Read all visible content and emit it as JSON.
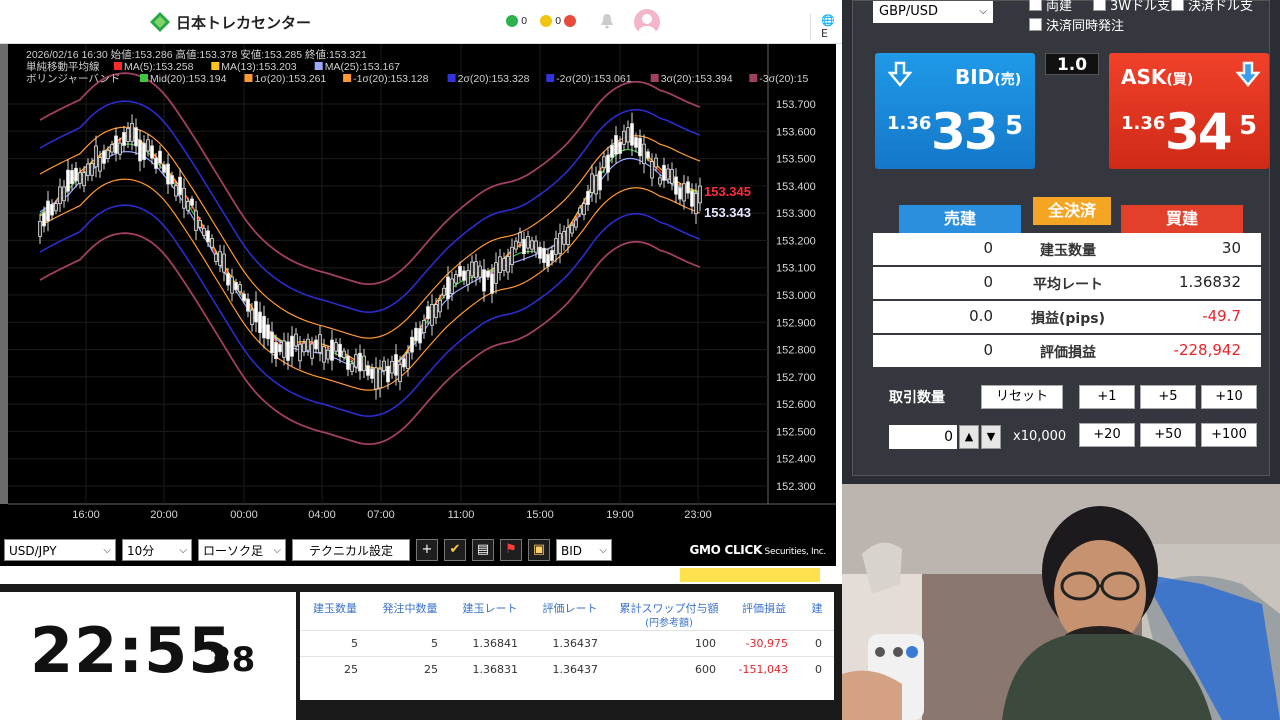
{
  "header": {
    "brand": "日本トレカセンター",
    "ind1": "0",
    "ind2": "0",
    "lang": "E"
  },
  "chart": {
    "info_line1": "2026/02/16 16:30 始値:153.286 高値:153.378 安値:153.285 終値:153.321",
    "info_line2_label": "単純移動平均線",
    "ma": [
      {
        "text": "MA(5):153.258",
        "color": "#ff2b2b"
      },
      {
        "text": "MA(13):153.203",
        "color": "#ffc21c"
      },
      {
        "text": "MA(25):153.167",
        "color": "#9aa8ff"
      }
    ],
    "info_line3_label": "ボリンジャーバンド",
    "bb": [
      {
        "text": "Mid(20):153.194",
        "color": "#3ec63e"
      },
      {
        "text": "1σ(20):153.261",
        "color": "#ff9933"
      },
      {
        "text": "-1σ(20):153.128",
        "color": "#ff9933"
      },
      {
        "text": "2σ(20):153.328",
        "color": "#3333dd"
      },
      {
        "text": "-2σ(20):153.061",
        "color": "#3333dd"
      },
      {
        "text": "3σ(20):153.394",
        "color": "#a04060"
      },
      {
        "text": "-3σ(20):15",
        "color": "#a04060"
      }
    ],
    "price_ask": "153.345",
    "price_bid": "153.343",
    "yticks": [
      "153.700",
      "153.600",
      "153.500",
      "153.400",
      "153.300",
      "153.200",
      "153.100",
      "153.000",
      "152.900",
      "152.800",
      "152.700",
      "152.600",
      "152.500",
      "152.400",
      "152.300"
    ],
    "xticks": [
      "16:00",
      "20:00",
      "00:00",
      "04:00",
      "07:00",
      "11:00",
      "15:00",
      "19:00",
      "23:00"
    ],
    "ylim": [
      152.3,
      153.7
    ]
  },
  "toolbar": {
    "pair": "USD/JPY",
    "timeframe": "10分",
    "chart_type": "ローソク足",
    "tech_btn": "テクニカル設定",
    "price_type": "BID",
    "logo_main": "GMO CLICK",
    "logo_sub": " Securities, Inc."
  },
  "order": {
    "pair": "GBP/USD",
    "cb1": "両建",
    "cb2": "3Wドル支",
    "cb3": "決済ドル支",
    "cb4": "決済同時発注",
    "bid_label": "BID",
    "bid_sub": "(売)",
    "bid_pre": "1.36",
    "bid_big": "33",
    "bid_small": "5",
    "ask_label": "ASK",
    "ask_sub": "(買)",
    "ask_pre": "1.36",
    "ask_big": "34",
    "ask_small": "5",
    "spread": "1.0",
    "sell_tab": "売建",
    "closeall_tab": "全決済",
    "buy_tab": "買建",
    "rows": [
      {
        "left": "0",
        "label": "建玉数量",
        "right": "30",
        "red": false
      },
      {
        "left": "0",
        "label": "平均レート",
        "right": "1.36832",
        "red": false
      },
      {
        "left": "0.0",
        "label": "損益(pips)",
        "right": "-49.7",
        "red": true
      },
      {
        "left": "0",
        "label": "評価損益",
        "right": "-228,942",
        "red": true
      }
    ],
    "qty_label": "取引数量",
    "reset": "リセット",
    "btns1": [
      "+1",
      "+5",
      "+10"
    ],
    "btns2": [
      "+20",
      "+50",
      "+100"
    ],
    "qty_value": "0",
    "multiplier": "x10,000"
  },
  "clock": {
    "hm": "22:55",
    "sec": "38"
  },
  "positions": {
    "headers": [
      "建玉数量",
      "発注中数量",
      "建玉レート",
      "評価レート",
      "累計スワップ付与額",
      "評価損益",
      "建"
    ],
    "headers_sub": "(円参考額)",
    "rows": [
      [
        "5",
        "5",
        "1.36841",
        "1.36437",
        "100",
        "-30,975",
        "0"
      ],
      [
        "25",
        "25",
        "1.36831",
        "1.36437",
        "600",
        "-151,043",
        "0"
      ]
    ]
  },
  "colors": {
    "bid": "#1a86d6",
    "ask": "#e0361f",
    "accent_red": "#e5252a",
    "header_blue": "#3a72c9"
  }
}
